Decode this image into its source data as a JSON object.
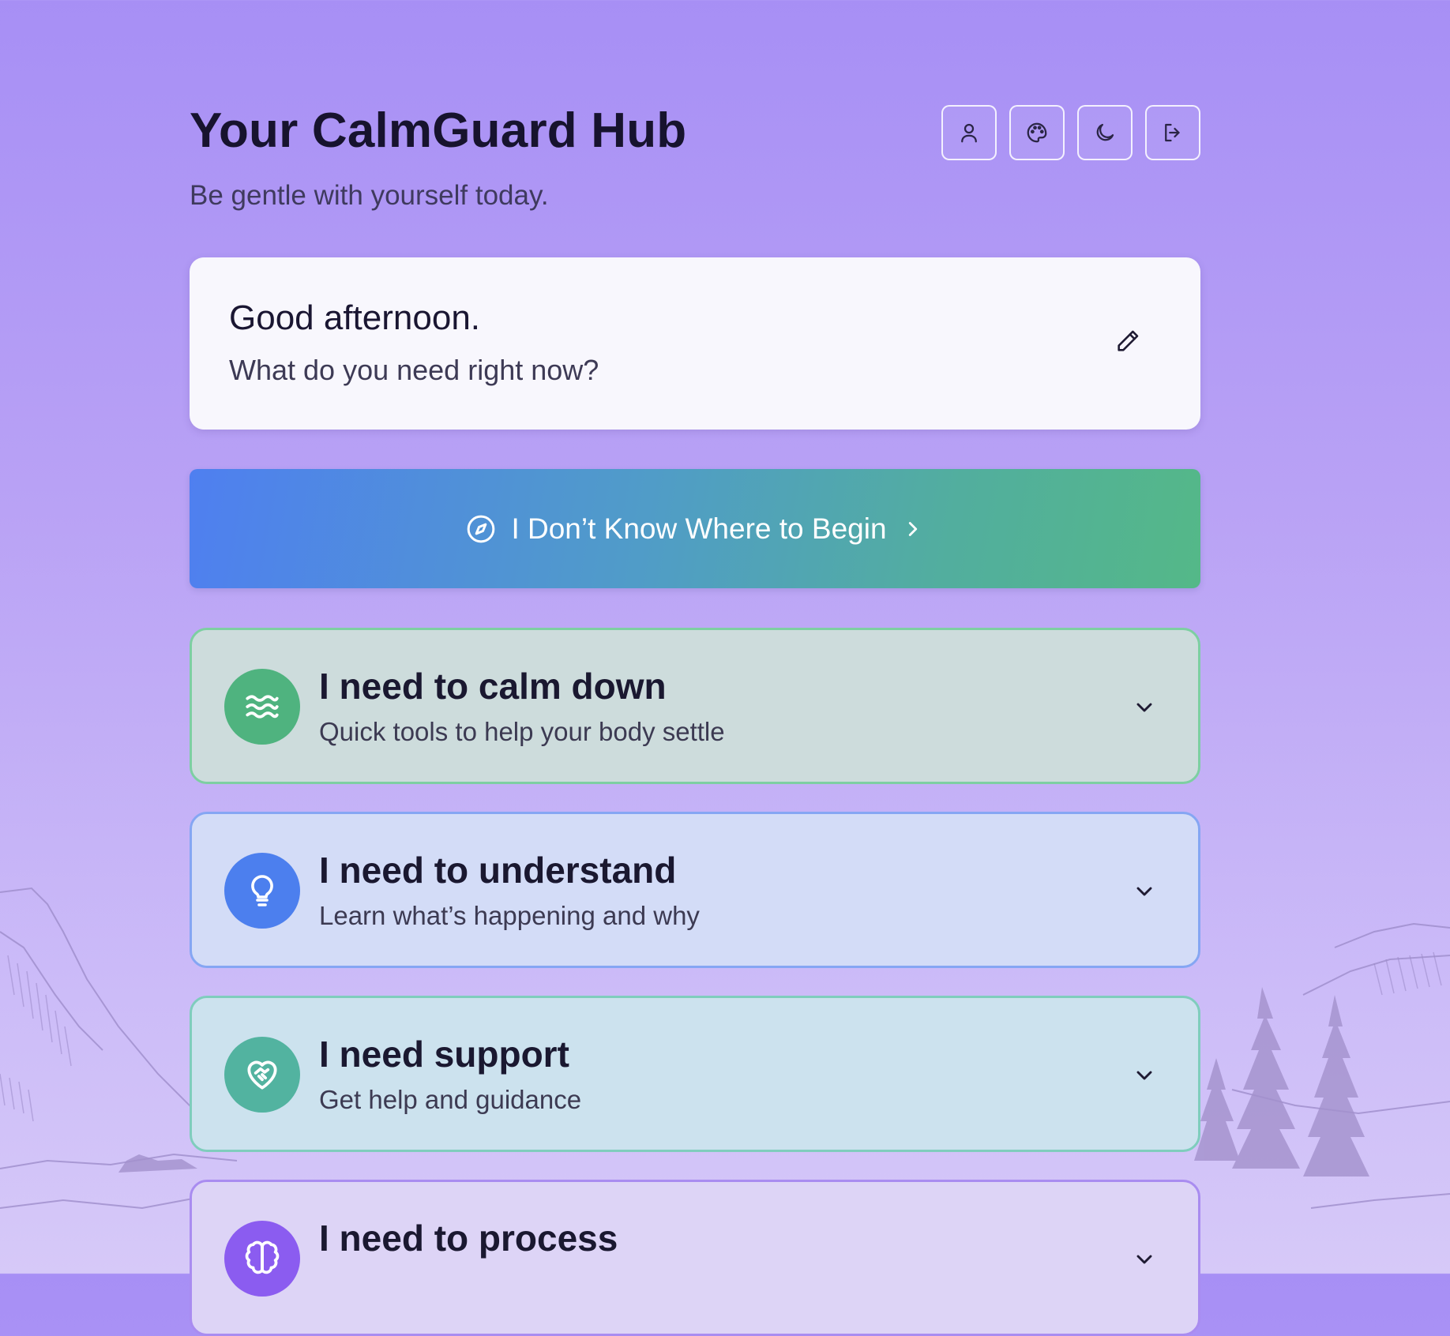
{
  "header": {
    "title": "Your CalmGuard Hub",
    "subtitle": "Be gentle with yourself today.",
    "actions": [
      {
        "icon": "user-icon"
      },
      {
        "icon": "palette-icon"
      },
      {
        "icon": "moon-icon"
      },
      {
        "icon": "logout-icon"
      }
    ]
  },
  "greeting": {
    "title": "Good afternoon.",
    "subtitle": "What do you need right now?",
    "edit_icon": "pencil-icon"
  },
  "begin": {
    "label": "I Don’t Know Where to Begin",
    "icon": "compass-icon",
    "trailing_icon": "chevron-right-icon"
  },
  "cards": [
    {
      "title": "I need to calm down",
      "subtitle": "Quick tools to help your body settle",
      "icon": "waves-icon",
      "color": "#4fb37f"
    },
    {
      "title": "I need to understand",
      "subtitle": "Learn what’s happening and why",
      "icon": "lightbulb-icon",
      "color": "#4c7fee"
    },
    {
      "title": "I need support",
      "subtitle": "Get help and guidance",
      "icon": "heart-handshake-icon",
      "color": "#52b3a0"
    },
    {
      "title": "I need to process",
      "subtitle": "",
      "icon": "brain-icon",
      "color": "#8b5cf0"
    }
  ],
  "colors": {
    "background_top": "#a78ff5",
    "background_bottom": "#d6c9f8",
    "card_calm_bg": "#cddcdc",
    "card_understand_bg": "#d3dcf7",
    "card_support_bg": "#cce2ee",
    "card_process_bg": "#ddd4f6"
  }
}
